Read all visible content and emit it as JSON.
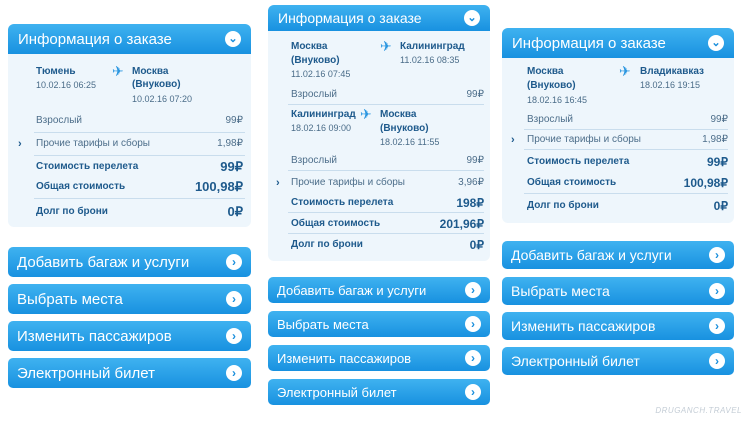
{
  "currency": "₽",
  "panel1": {
    "title": "Информация о заказе",
    "from_city": "Тюмень",
    "from_datetime": "10.02.16 06:25",
    "to_city_line1": "Москва",
    "to_city_line2": "(Внуково)",
    "to_datetime": "10.02.16 07:20",
    "adult_label": "Взрослый",
    "adult_price": "99",
    "other_fees_label": "Прочие тарифы и сборы",
    "other_fees_price": "1,98",
    "flight_cost_label": "Стоимость перелета",
    "flight_cost_value": "99",
    "total_label": "Общая стоимость",
    "total_value": "100,98",
    "debt_label": "Долг по брони",
    "debt_value": "0"
  },
  "panel2": {
    "title": "Информация о заказе",
    "seg1": {
      "from_city_line1": "Москва",
      "from_city_line2": "(Внуково)",
      "from_datetime": "11.02.16 07:45",
      "to_city": "Калининград",
      "to_datetime": "11.02.16 08:35"
    },
    "adult1_label": "Взрослый",
    "adult1_price": "99",
    "seg2": {
      "from_city": "Калининград",
      "from_datetime": "18.02.16 09:00",
      "to_city_line1": "Москва",
      "to_city_line2": "(Внуково)",
      "to_datetime": "18.02.16 11:55"
    },
    "adult2_label": "Взрослый",
    "adult2_price": "99",
    "other_fees_label": "Прочие тарифы и сборы",
    "other_fees_price": "3,96",
    "flight_cost_label": "Стоимость перелета",
    "flight_cost_value": "198",
    "total_label": "Общая стоимость",
    "total_value": "201,96",
    "debt_label": "Долг по брони",
    "debt_value": "0"
  },
  "panel3": {
    "title": "Информация о заказе",
    "from_city_line1": "Москва",
    "from_city_line2": "(Внуково)",
    "from_datetime": "18.02.16 16:45",
    "to_city": "Владикавказ",
    "to_datetime": "18.02.16 19:15",
    "adult_label": "Взрослый",
    "adult_price": "99",
    "other_fees_label": "Прочие тарифы и сборы",
    "other_fees_price": "1,98",
    "flight_cost_label": "Стоимость перелета",
    "flight_cost_value": "99",
    "total_label": "Общая стоимость",
    "total_value": "100,98",
    "debt_label": "Долг по брони",
    "debt_value": "0"
  },
  "buttons": {
    "add_baggage": "Добавить багаж и услуги",
    "choose_seats": "Выбрать места",
    "change_passengers": "Изменить пассажиров",
    "e_ticket": "Электронный билет"
  },
  "icons": {
    "expand": "chevron-down-icon",
    "go": "chevron-right-icon",
    "flight": "airplane-icon",
    "expand_row": "chevron-right-small-icon"
  },
  "colors": {
    "header_top": "#3fb2f0",
    "header_bottom": "#1891e0",
    "panel_bg": "#eef6fc",
    "text_dark": "#1e5a8c"
  },
  "watermark": "DRUGANCH.TRAVEL"
}
